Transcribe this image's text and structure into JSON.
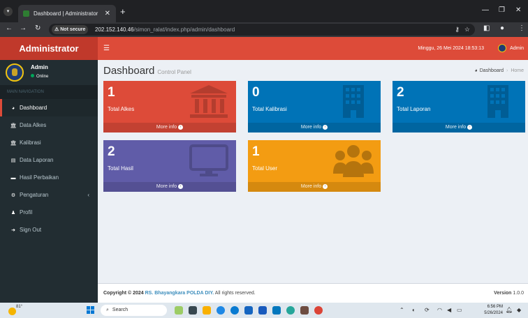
{
  "browser": {
    "tab_title": "Dashboard | Administrator",
    "tab_close": "✕",
    "new_tab": "+",
    "url_host": "202.152.140.46",
    "url_path": "/simon_ralat/index.php/admin/dashboard",
    "not_secure_label": "Not secure"
  },
  "app": {
    "brand": "Administrator",
    "datetime": "Minggu, 26 Mei 2024 18:53:13",
    "user_menu_name": "Admin"
  },
  "sidebar": {
    "user_name": "Admin",
    "status": "Online",
    "nav_header": "MAIN NAVIGATION",
    "items": [
      {
        "label": "Dashboard",
        "icon": "dashboard-icon"
      },
      {
        "label": "Data Alkes",
        "icon": "institution-icon"
      },
      {
        "label": "Kalibrasi",
        "icon": "institution-icon"
      },
      {
        "label": "Data Laporan",
        "icon": "document-icon"
      },
      {
        "label": "Hasil Perbaikan",
        "icon": "car-icon"
      },
      {
        "label": "Pengaturan",
        "icon": "cogs-icon"
      },
      {
        "label": "Profil",
        "icon": "user-icon"
      },
      {
        "label": "Sign Out",
        "icon": "sign-out-icon"
      }
    ]
  },
  "content": {
    "title": "Dashboard",
    "subtitle": "Control Panel",
    "breadcrumb": {
      "current": "Dashboard",
      "home": "Home"
    },
    "boxes": [
      {
        "count": "1",
        "label": "Total Alkes",
        "more": "More info",
        "color": "#dd4b39",
        "icon": "institution-icon"
      },
      {
        "count": "0",
        "label": "Total Kalibrasi",
        "more": "More info",
        "color": "#0073b7",
        "icon": "building-icon"
      },
      {
        "count": "2",
        "label": "Total Laporan",
        "more": "More info",
        "color": "#0073b7",
        "icon": "building-icon"
      },
      {
        "count": "2",
        "label": "Total Hasil",
        "more": "More info",
        "color": "#605ca8",
        "icon": "monitor-icon"
      },
      {
        "count": "1",
        "label": "Total User",
        "more": "More info",
        "color": "#f39c12",
        "icon": "users-icon"
      }
    ]
  },
  "footer": {
    "copyright_prefix": "Copyright © 2024",
    "org": "RS. Bhayangkara POLDA DIY.",
    "rights": "All rights reserved.",
    "version_label": "Version",
    "version": "1.0.0"
  },
  "taskbar": {
    "search_label": "Search",
    "temperature": "81°",
    "time": "6:56 PM",
    "date": "5/26/2024"
  }
}
